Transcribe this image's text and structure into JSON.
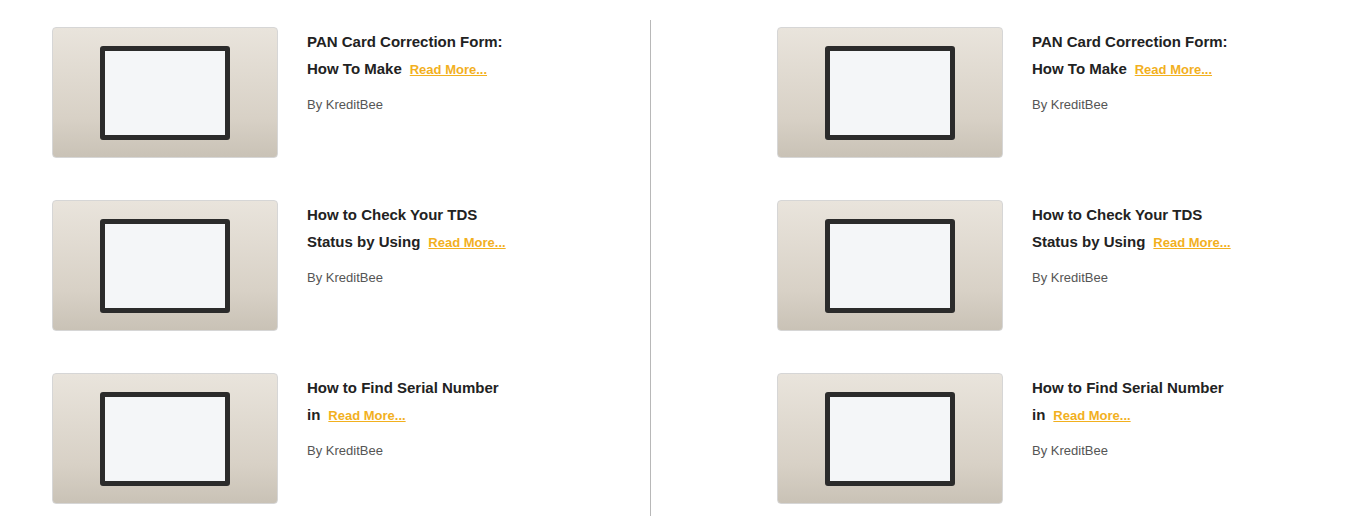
{
  "columns": [
    {
      "articles": [
        {
          "title_lines": [
            "PAN Card Correction Form:",
            "How To Make"
          ],
          "link": "Read More...",
          "author": "By KreditBee"
        },
        {
          "title_lines": [
            "How to Check Your TDS",
            "Status by Using"
          ],
          "link": "Read More...",
          "author": "By KreditBee"
        },
        {
          "title_lines": [
            "How to Find Serial Number",
            "in"
          ],
          "link": "Read More...",
          "author": "By KreditBee"
        }
      ]
    },
    {
      "articles": [
        {
          "title_lines": [
            "PAN Card Correction Form:",
            "How To Make"
          ],
          "link": "Read More...",
          "author": "By KreditBee"
        },
        {
          "title_lines": [
            "How to Check Your TDS",
            "Status by Using"
          ],
          "link": "Read More...",
          "author": "By KreditBee"
        },
        {
          "title_lines": [
            "How to Find Serial Number",
            "in"
          ],
          "link": "Read More...",
          "author": "By KreditBee"
        }
      ]
    }
  ]
}
